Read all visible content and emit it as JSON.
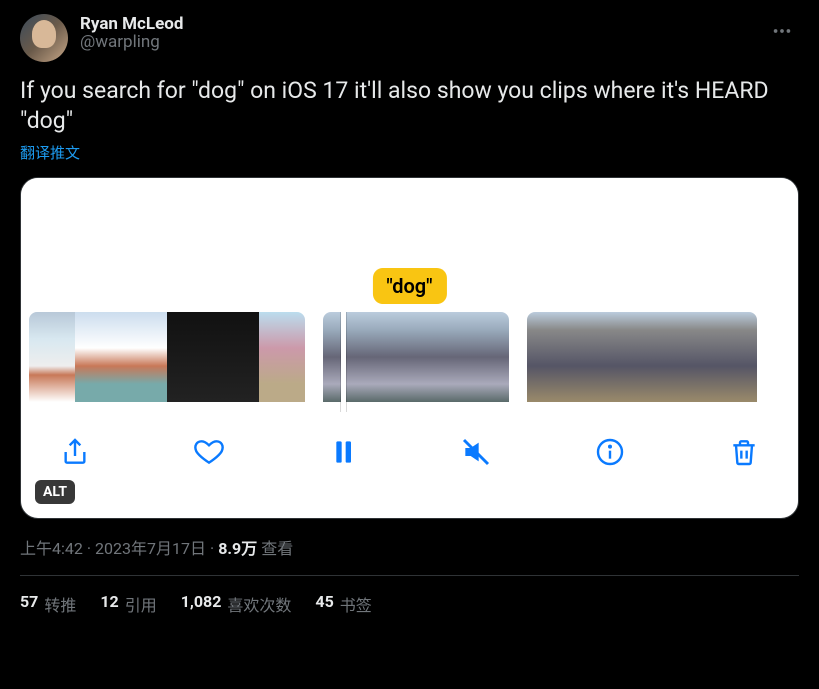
{
  "author": {
    "display_name": "Ryan McLeod",
    "handle": "@warpling"
  },
  "tweet_text": "If you search for \"dog\" on iOS 17 it'll also show you clips where it's HEARD \"dog\"",
  "translate_label": "翻译推文",
  "media": {
    "search_badge": "\"dog\"",
    "alt_label": "ALT"
  },
  "meta": {
    "time": "上午4:42",
    "sep1": " · ",
    "date": "2023年7月17日",
    "sep2": " · ",
    "views_count": "8.9万",
    "views_label": " 查看"
  },
  "stats": {
    "retweets_count": "57",
    "retweets_label": "转推",
    "quotes_count": "12",
    "quotes_label": "引用",
    "likes_count": "1,082",
    "likes_label": "喜欢次数",
    "bookmarks_count": "45",
    "bookmarks_label": "书签"
  }
}
